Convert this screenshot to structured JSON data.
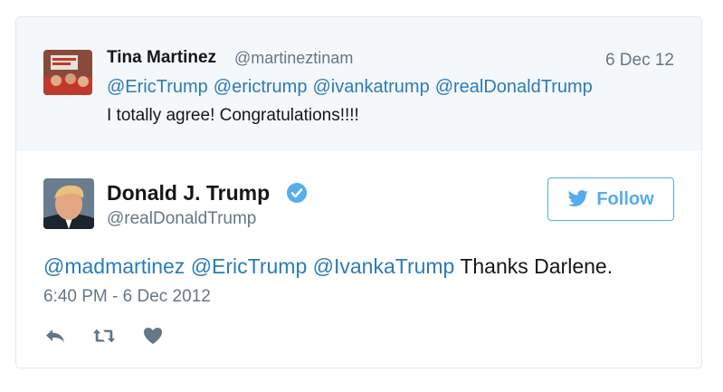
{
  "parent_tweet": {
    "name": "Tina Martinez",
    "handle": "@martineztinam",
    "date": "6 Dec 12",
    "mentions": [
      "@EricTrump",
      "@erictrump",
      "@ivankatrump",
      "@realDonaldTrump"
    ],
    "text": "I totally agree! Congratulations!!!!"
  },
  "main_tweet": {
    "name": "Donald J. Trump",
    "handle": "@realDonaldTrump",
    "follow_label": "Follow",
    "mentions": [
      "@madmartinez",
      "@EricTrump",
      "@IvankaTrump"
    ],
    "text": "Thanks Darlene.",
    "timestamp": "6:40 PM - 6 Dec 2012"
  },
  "icons": [
    "reply-icon",
    "retweet-icon",
    "like-icon",
    "verified-badge-icon",
    "twitter-bird-icon"
  ],
  "colors": {
    "link": "#2b7bb9",
    "accent": "#55acee",
    "muted": "#657786",
    "parent_bg": "#f5f8fa",
    "border": "#e1e8ed"
  }
}
